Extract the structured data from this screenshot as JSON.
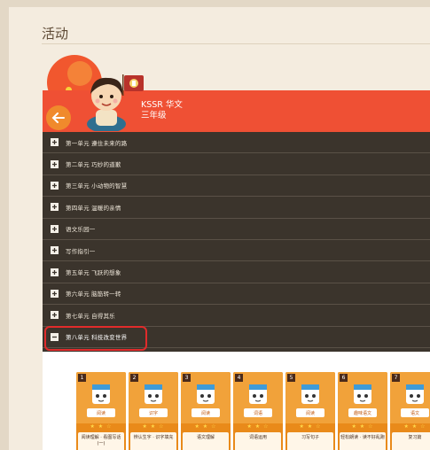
{
  "page": {
    "title": "活动"
  },
  "course": {
    "name": "KSSR 华文",
    "grade": "三年级"
  },
  "units": [
    {
      "label": "第一单元 遵住未来的路",
      "state": "collapsed"
    },
    {
      "label": "第二单元 巧妙的道歉",
      "state": "collapsed"
    },
    {
      "label": "第三单元 小动物的智慧",
      "state": "collapsed"
    },
    {
      "label": "第四单元 温暖的亲情",
      "state": "collapsed"
    },
    {
      "label": "语文乐园一",
      "state": "collapsed"
    },
    {
      "label": "写作指引一",
      "state": "collapsed"
    },
    {
      "label": "第五单元 飞跃的想象",
      "state": "collapsed"
    },
    {
      "label": "第六单元 脑筋转一转",
      "state": "collapsed"
    },
    {
      "label": "第七单元 自得其乐",
      "state": "collapsed"
    },
    {
      "label": "第八单元 科技改变世界",
      "state": "expanded"
    }
  ],
  "activities": [
    {
      "num": "1",
      "tag": "阅读",
      "stars": "★ ★ ☆",
      "name": "阅读理解 · 看图写话 (一)"
    },
    {
      "num": "2",
      "tag": "识字",
      "stars": "★ ★ ☆",
      "name": "辨认生字 · 识字填充"
    },
    {
      "num": "3",
      "tag": "阅读",
      "stars": "★ ★ ☆",
      "name": "语文理解"
    },
    {
      "num": "4",
      "tag": "词语",
      "stars": "★ ★ ☆",
      "name": "词语运用"
    },
    {
      "num": "5",
      "tag": "阅读",
      "stars": "★ ★ ☆",
      "name": "习写句子"
    },
    {
      "num": "6",
      "tag": "趣味语文",
      "stars": "★ ★ ☆",
      "name": "轻松朗读 · 读不好乱跑"
    },
    {
      "num": "7",
      "tag": "语文",
      "stars": "★ ★ ☆",
      "name": "复习篇"
    }
  ],
  "colors": {
    "accent": "#ef5034",
    "unit_bg": "#3b342c",
    "card": "#e98a1a",
    "highlight": "#e12b2b"
  },
  "icons": {
    "back": "back-arrow-icon",
    "expand": "plus-icon",
    "collapse": "minus-icon"
  }
}
